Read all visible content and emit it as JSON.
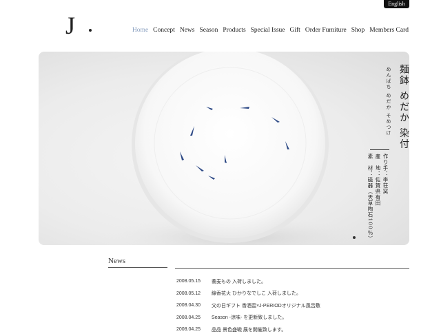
{
  "language_button": "English",
  "logo": {
    "letter": "J"
  },
  "nav": [
    {
      "label": "Home",
      "active": true
    },
    {
      "label": "Concept"
    },
    {
      "label": "News"
    },
    {
      "label": "Season"
    },
    {
      "label": "Products"
    },
    {
      "label": "Special Issue"
    },
    {
      "label": "Gift"
    },
    {
      "label": "Order Furniture"
    },
    {
      "label": "Shop"
    },
    {
      "label": "Members Card"
    }
  ],
  "hero": {
    "title": "麺鉢 めだか 染付",
    "kana": "めんばち めだか そめつけ",
    "maker": "作り手：李荘窯",
    "origin": "産　地：佐賀県有田",
    "material": "素　材：磁器（天草陶石100％）",
    "slide_count": 1,
    "active_slide": 1
  },
  "news": {
    "heading": "News",
    "items": [
      {
        "date": "2008.05.15",
        "title": "蕎麦もの 入荷しました。"
      },
      {
        "date": "2008.05.12",
        "title": "線香花火 ひかりなでしこ 入荷しました。"
      },
      {
        "date": "2008.04.30",
        "title": "父の日ギフト 香酒盃×J-PERIODオリジナル風呂敷"
      },
      {
        "date": "2008.04.25",
        "title": "Season -涼味- を更新致しました。"
      },
      {
        "date": "2008.04.25",
        "title": "品品 景色盛戦 展を開催致します。"
      }
    ]
  },
  "colors": {
    "active_nav": "#8aa0c0",
    "fish": "#2e4a86",
    "button_bg": "#111111"
  }
}
